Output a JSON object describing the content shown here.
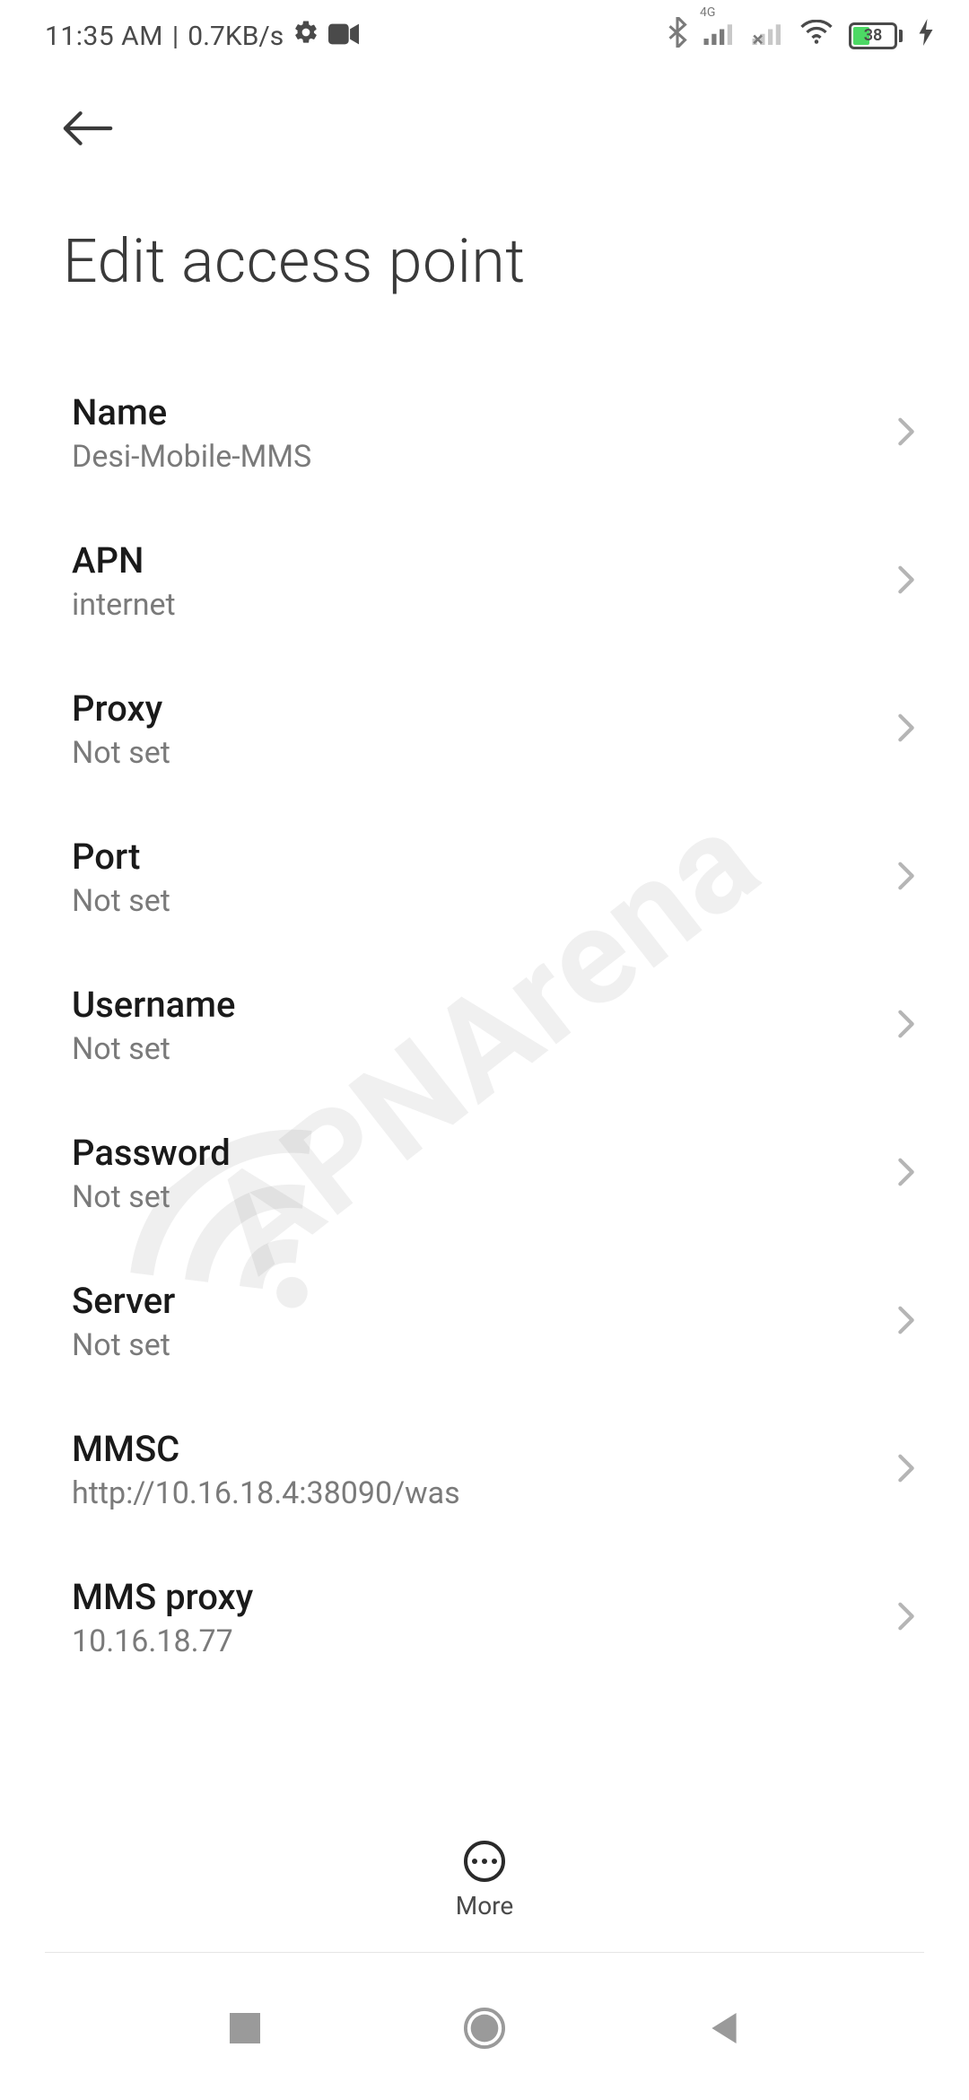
{
  "status": {
    "time": "11:35 AM",
    "separator": "|",
    "data_rate": "0.7KB/s",
    "network_label": "4G",
    "battery_percent": "38"
  },
  "header": {
    "title": "Edit access point"
  },
  "fields": [
    {
      "label": "Name",
      "value": "Desi-Mobile-MMS"
    },
    {
      "label": "APN",
      "value": "internet"
    },
    {
      "label": "Proxy",
      "value": "Not set"
    },
    {
      "label": "Port",
      "value": "Not set"
    },
    {
      "label": "Username",
      "value": "Not set"
    },
    {
      "label": "Password",
      "value": "Not set"
    },
    {
      "label": "Server",
      "value": "Not set"
    },
    {
      "label": "MMSC",
      "value": "http://10.16.18.4:38090/was"
    },
    {
      "label": "MMS proxy",
      "value": "10.16.18.77"
    }
  ],
  "bottom": {
    "more_label": "More"
  },
  "watermark": "APNArena"
}
